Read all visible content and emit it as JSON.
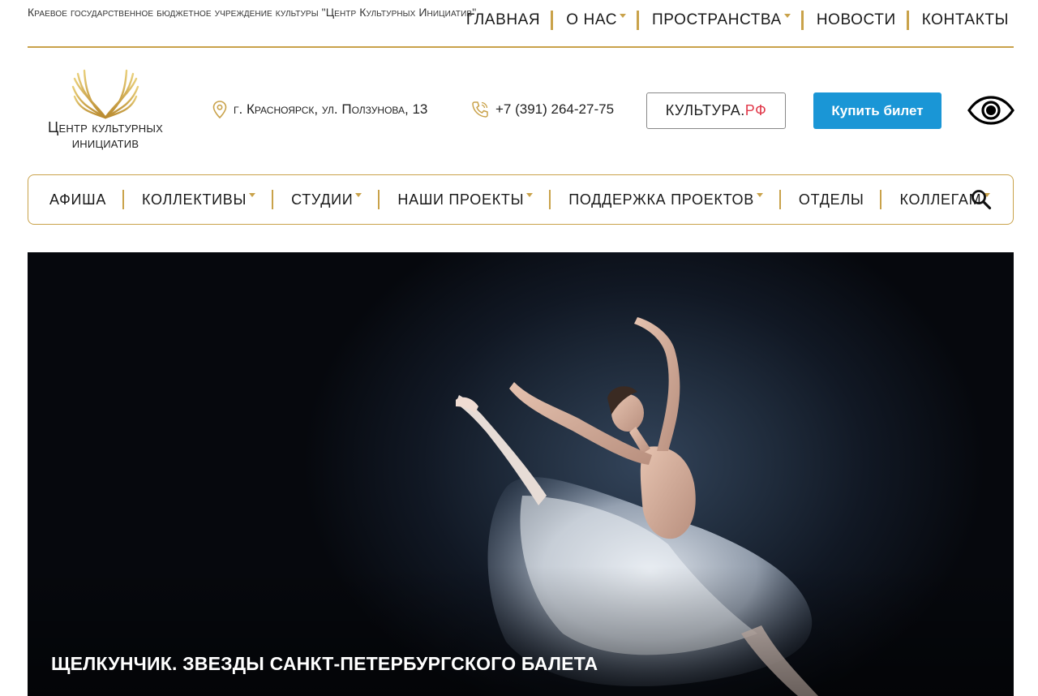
{
  "header": {
    "org_name": "Краевое государственное бюджетное учреждение культуры \"Центр Культурных Инициатив\"",
    "top_nav": [
      {
        "label": "ГЛАВНАЯ",
        "dropdown": false
      },
      {
        "label": "О НАС",
        "dropdown": true
      },
      {
        "label": "ПРОСТРАНСТВА",
        "dropdown": true
      },
      {
        "label": "НОВОСТИ",
        "dropdown": false
      },
      {
        "label": "КОНТАКТЫ",
        "dropdown": false
      }
    ]
  },
  "brand": {
    "logo_line1": "Центр культурных",
    "logo_line2": "инициатив",
    "accent_color": "#c9a24a"
  },
  "contacts": {
    "address": "г. Красноярск, ул. Ползунова, 13",
    "phone": "+7 (391) 264-27-75"
  },
  "buttons": {
    "kultura_main": "КУЛЬТУРА.",
    "kultura_rf": "РФ",
    "buy_ticket": "Купить билет",
    "buy_color": "#1a96d6"
  },
  "main_nav": [
    {
      "label": "АФИША",
      "dropdown": false
    },
    {
      "label": "КОЛЛЕКТИВЫ",
      "dropdown": true
    },
    {
      "label": "СТУДИИ",
      "dropdown": true
    },
    {
      "label": "НАШИ ПРОЕКТЫ",
      "dropdown": true
    },
    {
      "label": "ПОДДЕРЖКА ПРОЕКТОВ",
      "dropdown": true
    },
    {
      "label": "ОТДЕЛЫ",
      "dropdown": false
    },
    {
      "label": "КОЛЛЕГАМ",
      "dropdown": true
    }
  ],
  "hero": {
    "title": "ЩЕЛКУНЧИК. ЗВЕЗДЫ САНКТ-ПЕТЕРБУРГСКОГО БАЛЕТА"
  },
  "icons": {
    "location": "map-pin-icon",
    "phone": "phone-icon",
    "accessibility": "eye-icon",
    "search": "search-icon"
  }
}
